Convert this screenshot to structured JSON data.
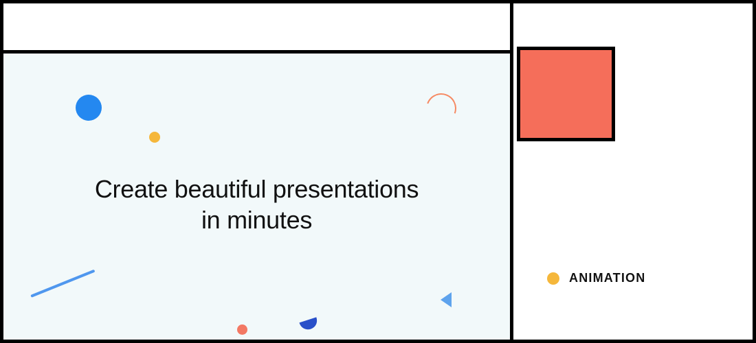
{
  "slide": {
    "title": "Create beautiful presentations\nin minutes",
    "background": "#f2f9fa"
  },
  "category": {
    "label": "ANIMATION",
    "dot_color": "#f5b73b"
  },
  "accent": {
    "square_color": "#f56e5a"
  }
}
